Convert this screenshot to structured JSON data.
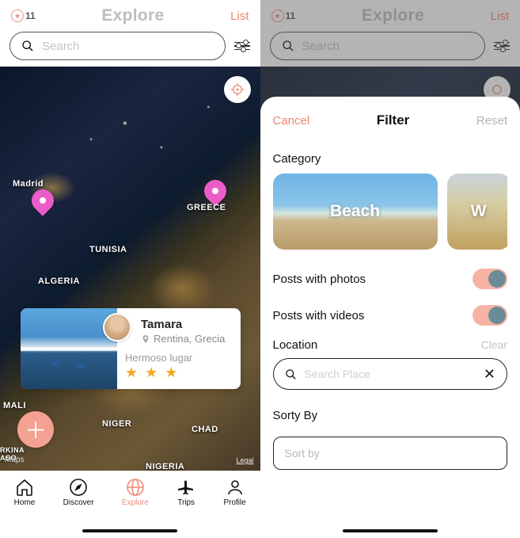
{
  "header": {
    "points": "11",
    "title": "Explore",
    "list_label": "List"
  },
  "search": {
    "placeholder": "Search"
  },
  "map": {
    "pins": [
      "Madrid",
      "Greece"
    ],
    "labels": {
      "madrid": "Madrid",
      "greece": "GREECE",
      "tunisia": "TUNISIA",
      "algeria": "ALGERIA",
      "mali": "MALI",
      "niger": "NIGER",
      "chad": "CHAD",
      "burkina": "RKINA\nASO",
      "nigeria": "NIGERIA"
    },
    "attribution": " Maps",
    "legal": "Legal"
  },
  "card": {
    "name": "Tamara",
    "location": "Rentina, Grecia",
    "caption": "Hermoso lugar",
    "stars": "★ ★ ★",
    "rating_value": 3
  },
  "tabs": {
    "home": "Home",
    "discover": "Discover",
    "explore": "Explore",
    "trips": "Trips",
    "profile": "Profile"
  },
  "filter": {
    "cancel": "Cancel",
    "title": "Filter",
    "reset": "Reset",
    "category_label": "Category",
    "categories": [
      {
        "label": "Beach"
      },
      {
        "label": "W"
      }
    ],
    "toggles": {
      "photos_label": "Posts with photos",
      "photos_on": true,
      "videos_label": "Posts with videos",
      "videos_on": true
    },
    "location_label": "Location",
    "clear_label": "Clear",
    "location_placeholder": "Search Place",
    "sortby_label": "Sorty By",
    "sortby_placeholder": "Sort by"
  }
}
